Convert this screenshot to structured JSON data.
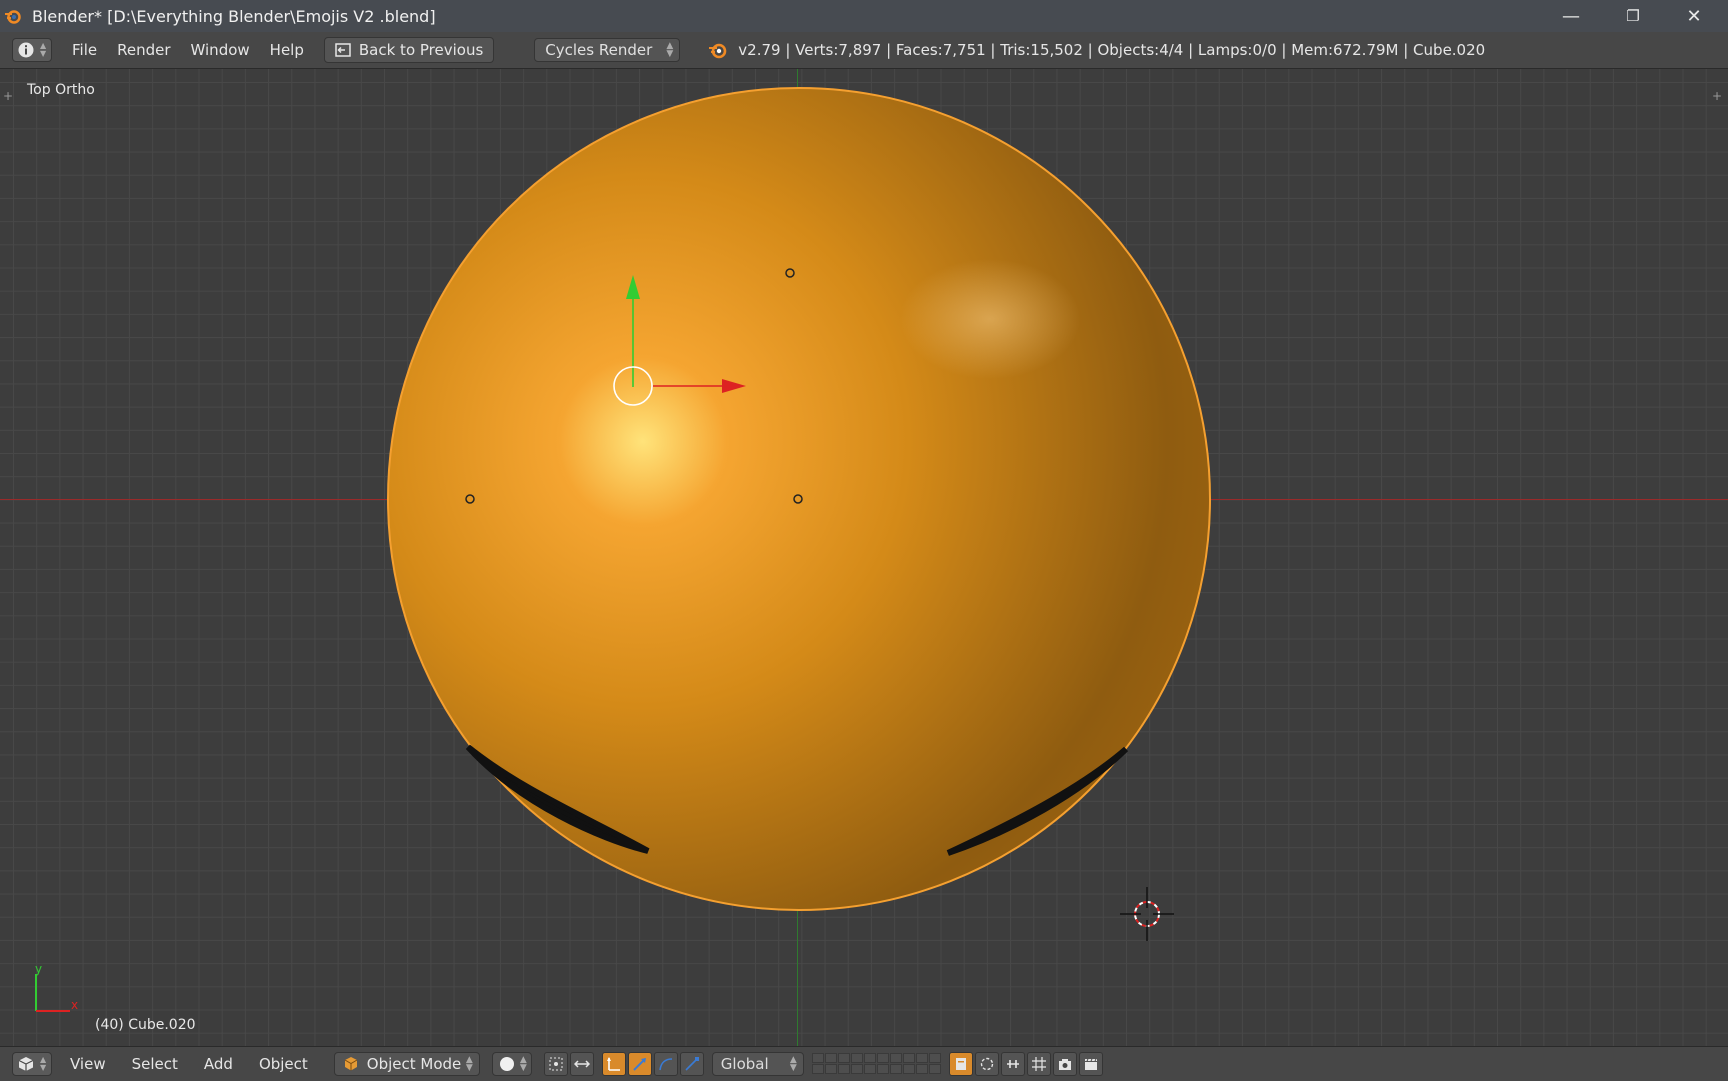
{
  "window": {
    "title": "Blender* [D:\\Everything Blender\\Emojis V2 .blend]",
    "controls": {
      "minimize": "—",
      "restore": "❐",
      "close": "✕"
    }
  },
  "menubar": {
    "menus": [
      "File",
      "Render",
      "Window",
      "Help"
    ],
    "back_label": "Back to Previous",
    "render_engine": "Cycles Render",
    "stats": "v2.79 | Verts:7,897 | Faces:7,751 | Tris:15,502 | Objects:4/4 | Lamps:0/0 | Mem:672.79M | Cube.020"
  },
  "viewport": {
    "view_name": "Top Ortho",
    "object_label": "(40) Cube.020",
    "axis_labels": {
      "y": "y",
      "x": "x"
    },
    "colors": {
      "object": "#e0921e",
      "outline": "#f5a030",
      "grid": "#484848",
      "x_axis": "#9a2a2a",
      "y_axis": "#2f7a2f"
    }
  },
  "bottombar": {
    "menus": [
      "View",
      "Select",
      "Add",
      "Object"
    ],
    "mode": "Object Mode",
    "orientation": "Global"
  }
}
